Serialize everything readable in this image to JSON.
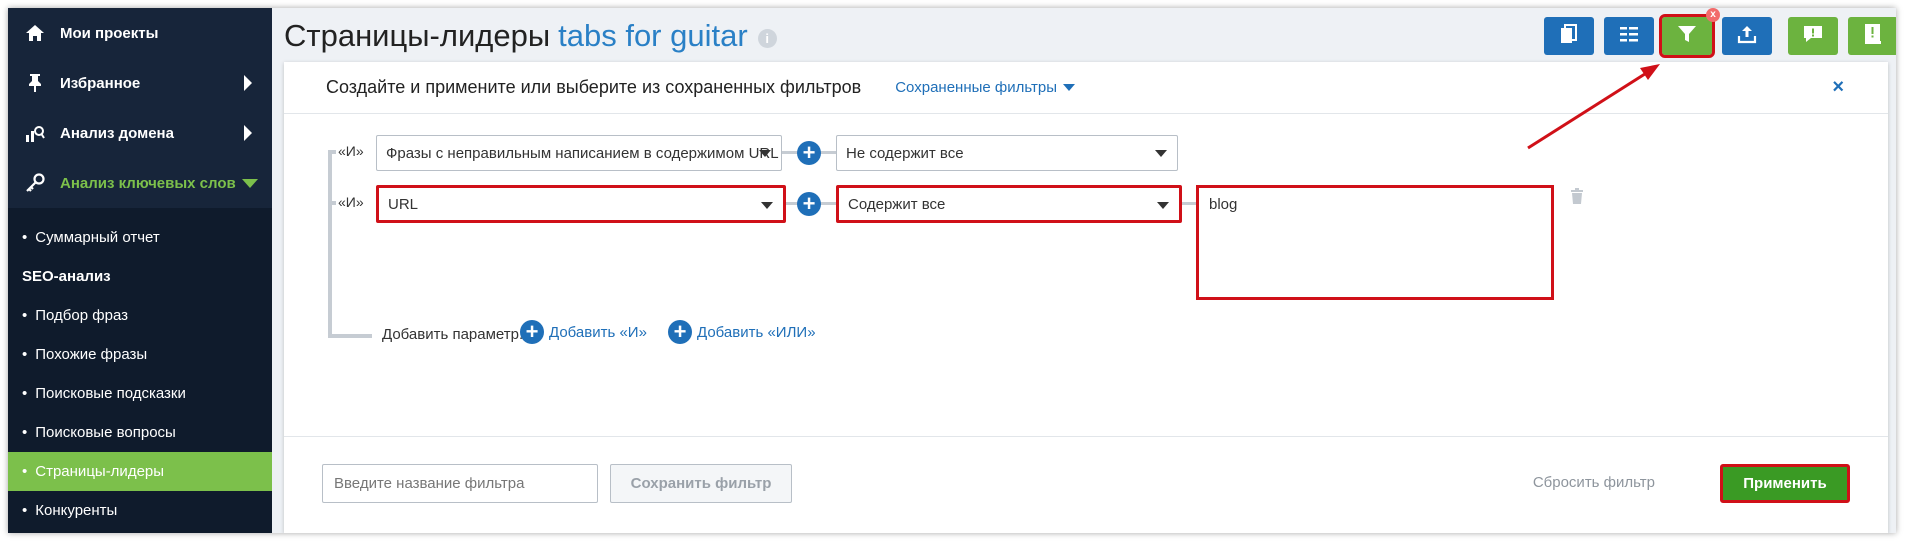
{
  "sidebar": {
    "main_items": [
      {
        "label": "Мои проекты",
        "icon": "home-icon"
      },
      {
        "label": "Избранное",
        "icon": "pin-icon"
      },
      {
        "label": "Анализ домена",
        "icon": "domain-analysis-icon"
      },
      {
        "label": "Анализ ключевых слов",
        "icon": "key-icon"
      }
    ],
    "sub_items": [
      {
        "label": "Суммарный отчет"
      },
      {
        "label": "SEO-анализ"
      },
      {
        "label": "Подбор фраз"
      },
      {
        "label": "Похожие фразы"
      },
      {
        "label": "Поисковые подсказки"
      },
      {
        "label": "Поисковые вопросы"
      },
      {
        "label": "Страницы-лидеры"
      },
      {
        "label": "Конкуренты"
      }
    ],
    "bullet": "•",
    "accent_color": "#7cc04b",
    "bg_color": "#17253a"
  },
  "header": {
    "title": "Страницы-лидеры",
    "subtitle": "tabs for guitar",
    "info_icon": "info-icon",
    "toolbar": [
      {
        "icon": "copy-icon"
      },
      {
        "icon": "columns-icon"
      },
      {
        "icon": "filter-icon",
        "badge": "x"
      },
      {
        "icon": "export-icon"
      },
      {
        "icon": "feedback-icon"
      },
      {
        "icon": "help-book-icon"
      }
    ]
  },
  "filter_panel": {
    "title": "Создайте и примените или выберите из сохраненных фильтров",
    "saved_filters_label": "Сохраненные фильтры",
    "close_label": "×",
    "rows": [
      {
        "logic": "«И»",
        "field": "Фразы с неправильным написанием в содержимом URL",
        "condition": "Не содержит все",
        "value": ""
      },
      {
        "logic": "«И»",
        "field": "URL",
        "condition": "Содержит все",
        "value": "blog"
      }
    ],
    "add_param_label": "Добавить параметр:",
    "add_and_label": "Добавить «И»",
    "add_or_label": "Добавить «ИЛИ»",
    "filter_name_placeholder": "Введите название фильтра",
    "save_filter_label": "Сохранить фильтр",
    "reset_filter_label": "Сбросить фильтр",
    "apply_label": "Применить"
  },
  "colors": {
    "brand_blue": "#1f6fb8",
    "green": "#6cb33f",
    "highlight_red": "#d01018"
  }
}
